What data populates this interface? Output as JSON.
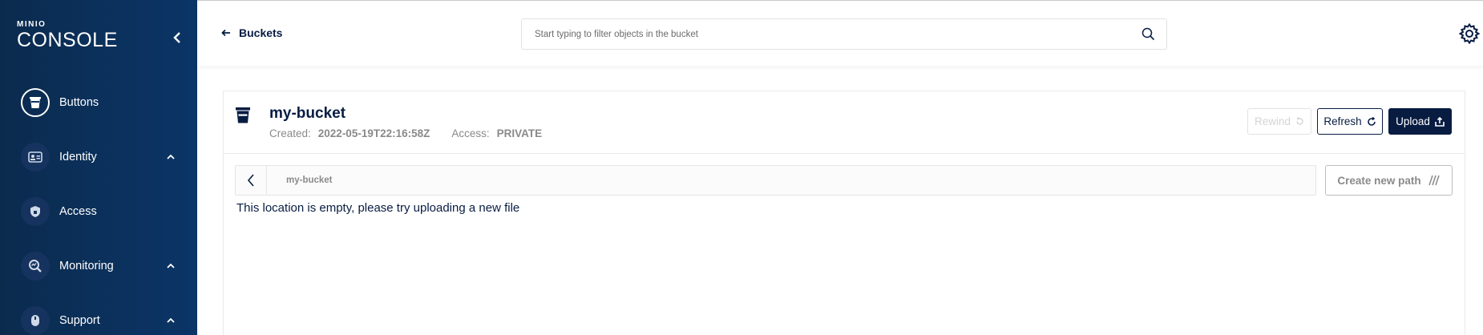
{
  "app": {
    "logo_small": "MINIO",
    "logo_big": "CONSOLE"
  },
  "sidebar": {
    "items": [
      {
        "label": "Buttons"
      },
      {
        "label": "Identity"
      },
      {
        "label": "Access"
      },
      {
        "label": "Monitoring"
      },
      {
        "label": "Support"
      }
    ]
  },
  "topbar": {
    "back_label": "Buckets",
    "search_placeholder": "Start typing to filter objects in the bucket"
  },
  "bucket": {
    "name": "my-bucket",
    "created_label": "Created:",
    "created_value": "2022-05-19T22:16:58Z",
    "access_label": "Access:",
    "access_value": "PRIVATE"
  },
  "actions": {
    "rewind": "Rewind",
    "refresh": "Refresh",
    "upload": "Upload",
    "create_path": "Create new path"
  },
  "path": {
    "current": "my-bucket"
  },
  "empty_message": "This location is empty, please try uploading a new file",
  "colors": {
    "sidebar_bg": "#0b3567",
    "primary": "#081c42",
    "muted": "#8a8a8a"
  }
}
